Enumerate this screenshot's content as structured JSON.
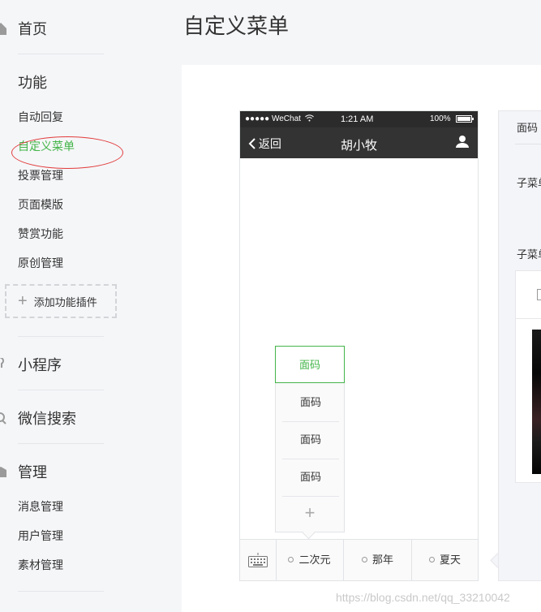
{
  "sidebar": {
    "home": "首页",
    "features": "功能",
    "feature_items": [
      "自动回复",
      "自定义菜单",
      "投票管理",
      "页面模版",
      "赞赏功能",
      "原创管理"
    ],
    "add_plugin": "添加功能插件",
    "mini_program": "小程序",
    "wechat_search": "微信搜索",
    "manage": "管理",
    "manage_items": [
      "消息管理",
      "用户管理",
      "素材管理"
    ]
  },
  "main": {
    "title": "自定义菜单"
  },
  "phone": {
    "carrier": "●●●●● WeChat",
    "time": "1:21 AM",
    "battery": "100%",
    "back": "返回",
    "account_name": "胡小牧",
    "submenu": [
      "面码",
      "面码",
      "面码",
      "面码"
    ],
    "submenu_add": "+",
    "menu": [
      "二次元",
      "那年",
      "夏天"
    ]
  },
  "editor": {
    "title": "面码",
    "label1": "子菜单",
    "label2": "子菜单"
  },
  "watermark": "https://blog.csdn.net/qq_33210042",
  "colors": {
    "accent": "#44b549",
    "annotation": "#e23b3b",
    "navbar": "#333333"
  }
}
